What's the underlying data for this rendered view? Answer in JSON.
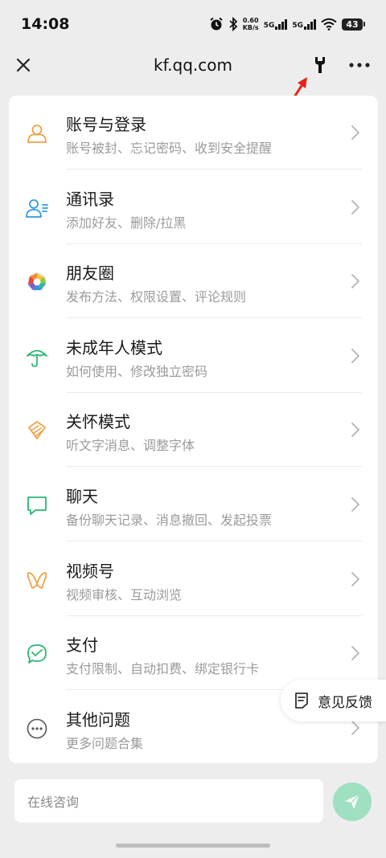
{
  "status_bar": {
    "time": "14:08",
    "net_speed_value": "0.60",
    "net_speed_unit": "KB/s",
    "signal1_label": "5G",
    "signal2_label": "5G",
    "battery": "43",
    "icons": [
      "alarm-icon",
      "bluetooth-icon",
      "signal-icon",
      "wifi-icon",
      "battery-icon"
    ]
  },
  "nav": {
    "title": "kf.qq.com",
    "close_icon": "close-icon",
    "tool_icon": "wrench-icon",
    "more_icon": "more-icon"
  },
  "menu": {
    "items": [
      {
        "title": "账号与登录",
        "desc": "账号被封、忘记密码、收到安全提醒",
        "icon": "user-icon",
        "color": "#f0a144"
      },
      {
        "title": "通讯录",
        "desc": "添加好友、删除/拉黑",
        "icon": "contacts-icon",
        "color": "#2f9ce8"
      },
      {
        "title": "朋友圈",
        "desc": "发布方法、权限设置、评论规则",
        "icon": "moments-icon",
        "color": "#f0a144"
      },
      {
        "title": "未成年人模式",
        "desc": "如何使用、修改独立密码",
        "icon": "umbrella-icon",
        "color": "#2bb673"
      },
      {
        "title": "关怀模式",
        "desc": "听文字消息、调整字体",
        "icon": "care-icon",
        "color": "#f0a144"
      },
      {
        "title": "聊天",
        "desc": "备份聊天记录、消息撤回、发起投票",
        "icon": "chat-icon",
        "color": "#2bb673"
      },
      {
        "title": "视频号",
        "desc": "视频审核、互动浏览",
        "icon": "channels-icon",
        "color": "#f0a144"
      },
      {
        "title": "支付",
        "desc": "支付限制、自动扣费、绑定银行卡",
        "icon": "pay-icon",
        "color": "#2bb673"
      },
      {
        "title": "其他问题",
        "desc": "更多问题合集",
        "icon": "more-circle-icon",
        "color": "#555555"
      }
    ]
  },
  "feedback": {
    "label": "意见反馈",
    "icon": "feedback-icon"
  },
  "input": {
    "placeholder": "在线咨询"
  },
  "send": {
    "icon": "send-icon",
    "color": "#9fe0c0"
  }
}
